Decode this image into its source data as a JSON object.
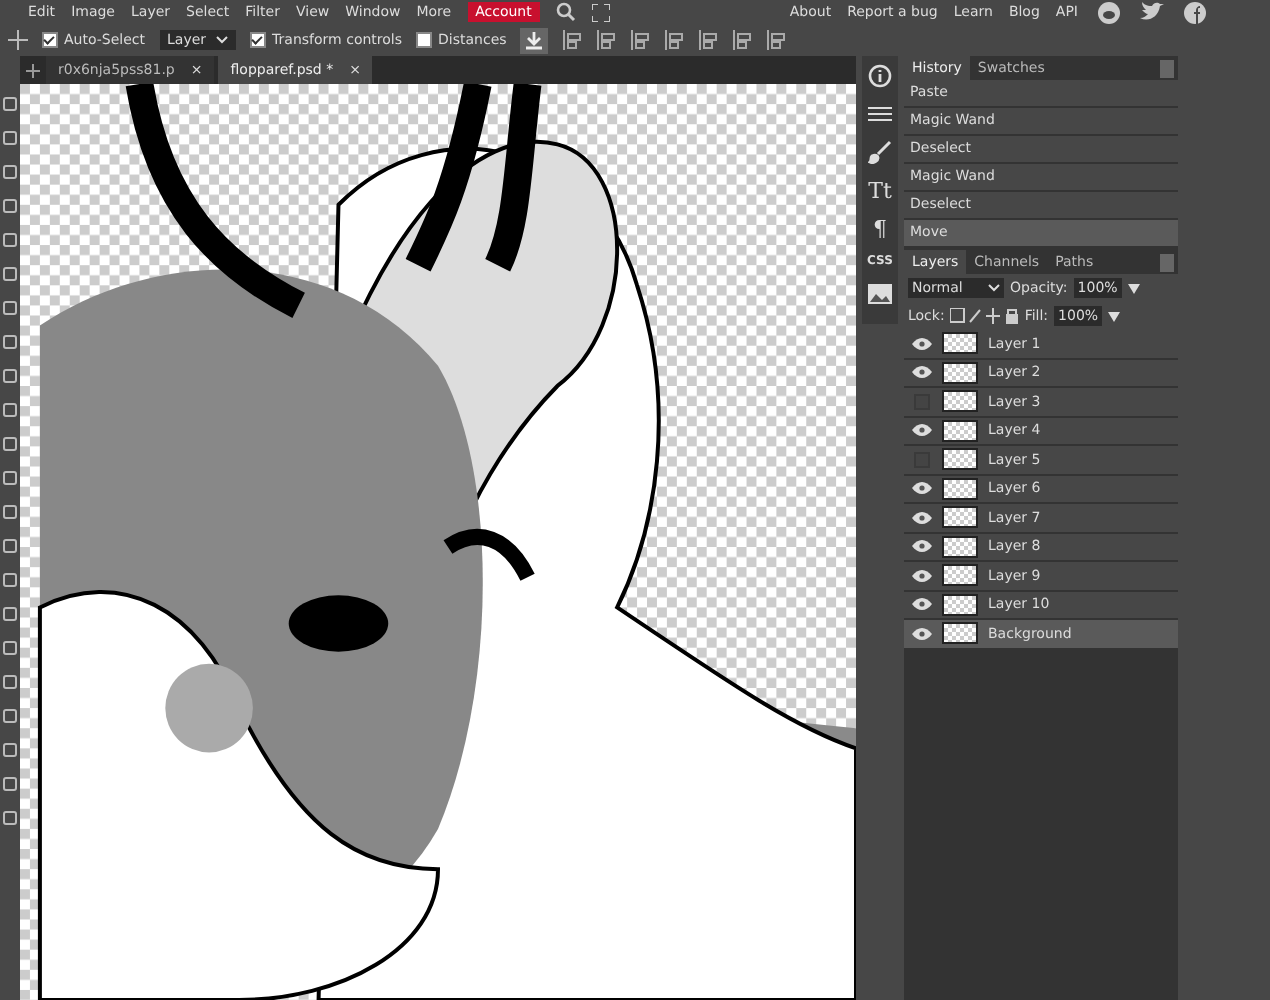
{
  "menu": {
    "items": [
      "Edit",
      "Image",
      "Layer",
      "Select",
      "Filter",
      "View",
      "Window",
      "More"
    ],
    "account": "Account",
    "links": [
      "About",
      "Report a bug",
      "Learn",
      "Blog",
      "API"
    ]
  },
  "options_bar": {
    "auto_select": {
      "label": "Auto-Select",
      "checked": true
    },
    "target": "Layer",
    "transform_controls": {
      "label": "Transform controls",
      "checked": true
    },
    "distances": {
      "label": "Distances",
      "checked": false
    }
  },
  "document_tabs": [
    {
      "label": "r0x6nja5pss81.p",
      "selected": false,
      "close": "×"
    },
    {
      "label": "flopparef.psd *",
      "selected": true,
      "close": "×"
    }
  ],
  "side_tools": [
    "Tt",
    "¶",
    "CSS"
  ],
  "history_panel": {
    "tabs": [
      {
        "label": "History",
        "selected": true
      },
      {
        "label": "Swatches",
        "selected": false
      }
    ],
    "items": [
      {
        "label": "Paste",
        "selected": false
      },
      {
        "label": "Magic Wand",
        "selected": false
      },
      {
        "label": "Deselect",
        "selected": false
      },
      {
        "label": "Magic Wand",
        "selected": false
      },
      {
        "label": "Deselect",
        "selected": false
      },
      {
        "label": "Move",
        "selected": true
      }
    ]
  },
  "layers_panel": {
    "tabs": [
      {
        "label": "Layers",
        "selected": true
      },
      {
        "label": "Channels",
        "selected": false
      },
      {
        "label": "Paths",
        "selected": false
      }
    ],
    "blend_mode": "Normal",
    "opacity_label": "Opacity:",
    "opacity": "100%",
    "lock_label": "Lock:",
    "fill_label": "Fill:",
    "fill": "100%",
    "layers": [
      {
        "name": "Layer 1",
        "visible": true,
        "selected": false
      },
      {
        "name": "Layer 2",
        "visible": true,
        "selected": false
      },
      {
        "name": "Layer 3",
        "visible": false,
        "selected": false
      },
      {
        "name": "Layer 4",
        "visible": true,
        "selected": false
      },
      {
        "name": "Layer 5",
        "visible": false,
        "selected": false
      },
      {
        "name": "Layer 6",
        "visible": true,
        "selected": false
      },
      {
        "name": "Layer 7",
        "visible": true,
        "selected": false
      },
      {
        "name": "Layer 8",
        "visible": true,
        "selected": false
      },
      {
        "name": "Layer 9",
        "visible": true,
        "selected": false
      },
      {
        "name": "Layer 10",
        "visible": true,
        "selected": false
      },
      {
        "name": "Background",
        "visible": true,
        "selected": true
      }
    ]
  }
}
